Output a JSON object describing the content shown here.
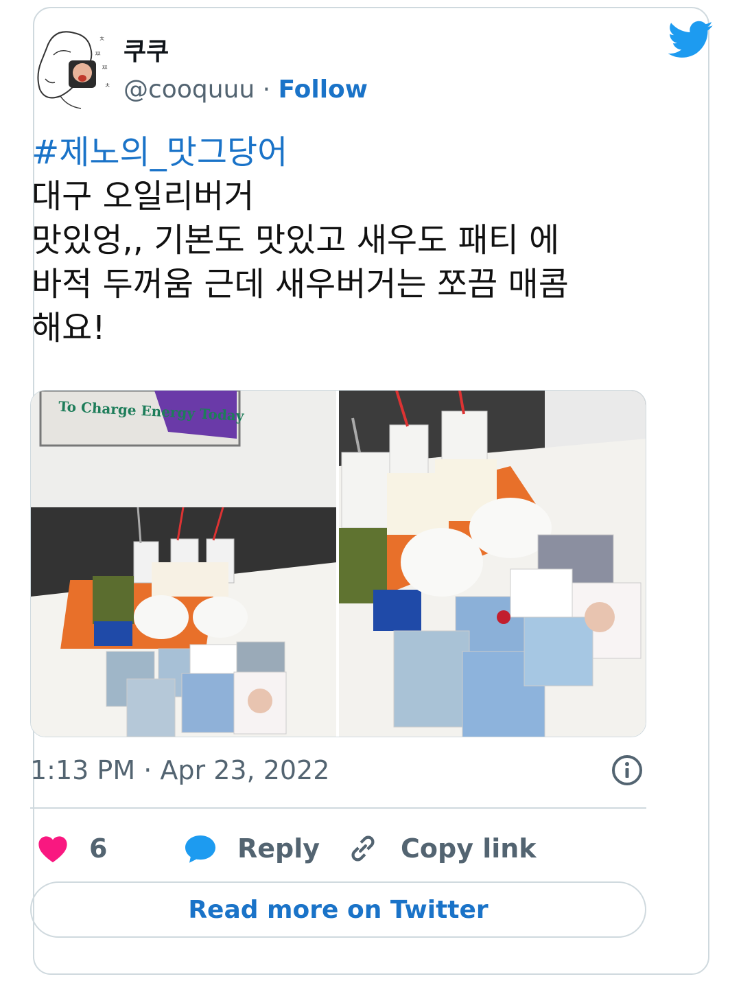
{
  "author": {
    "display_name": "쿠쿠",
    "handle": "@cooquuu",
    "separator": " · ",
    "follow_label": "Follow"
  },
  "tweet": {
    "hashtag": "#제노의_맛그당어",
    "lines": [
      "대구 오일리버거",
      "맛있엉,, 기본도 맛있고 새우도 패티 에",
      "바적 두꺼움 근데 새우버거는 쪼끔 매콤",
      "해요!"
    ]
  },
  "media": {
    "left_sign_text": "To Charge Energy Today"
  },
  "meta": {
    "time": "1:13 PM",
    "separator": " · ",
    "date": "Apr 23, 2022"
  },
  "actions": {
    "like_count": "6",
    "reply_label": "Reply",
    "copy_link_label": "Copy link"
  },
  "read_more_label": "Read more on Twitter",
  "colors": {
    "link": "#1a73c8",
    "twitter_blue": "#1d9bf0",
    "heart": "#f91880",
    "muted": "#536471",
    "border": "#cfd9de"
  }
}
